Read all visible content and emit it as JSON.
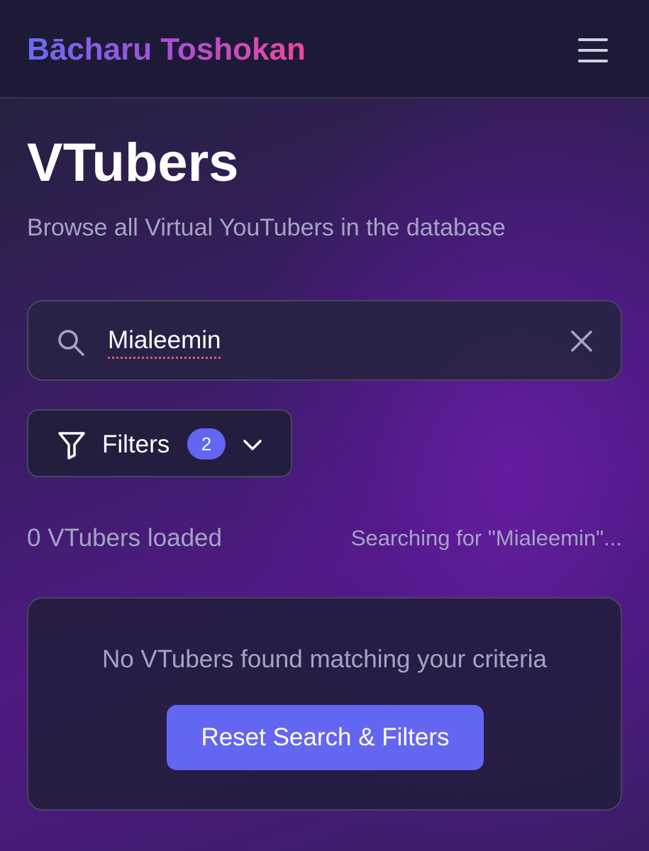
{
  "header": {
    "brand": "Bācharu Toshokan",
    "menu_icon": "hamburger-menu-icon"
  },
  "page": {
    "title": "VTubers",
    "subtitle": "Browse all Virtual YouTubers in the database"
  },
  "search": {
    "value": "Mialeemin",
    "search_icon": "search-icon",
    "clear_icon": "close-icon"
  },
  "filters": {
    "label": "Filters",
    "active_count": "2",
    "filter_icon": "funnel-icon",
    "toggle_icon": "chevron-down-icon"
  },
  "results": {
    "count_text": "0 VTubers loaded",
    "status_text": "Searching for \"Mialeemin\"..."
  },
  "empty_state": {
    "message": "No VTubers found matching your criteria",
    "reset_label": "Reset Search & Filters"
  },
  "colors": {
    "accent": "#6366f1",
    "brand_gradient_start": "#6b6cf5",
    "brand_gradient_end": "#ec4899",
    "muted_text": "#a4a5c4"
  }
}
